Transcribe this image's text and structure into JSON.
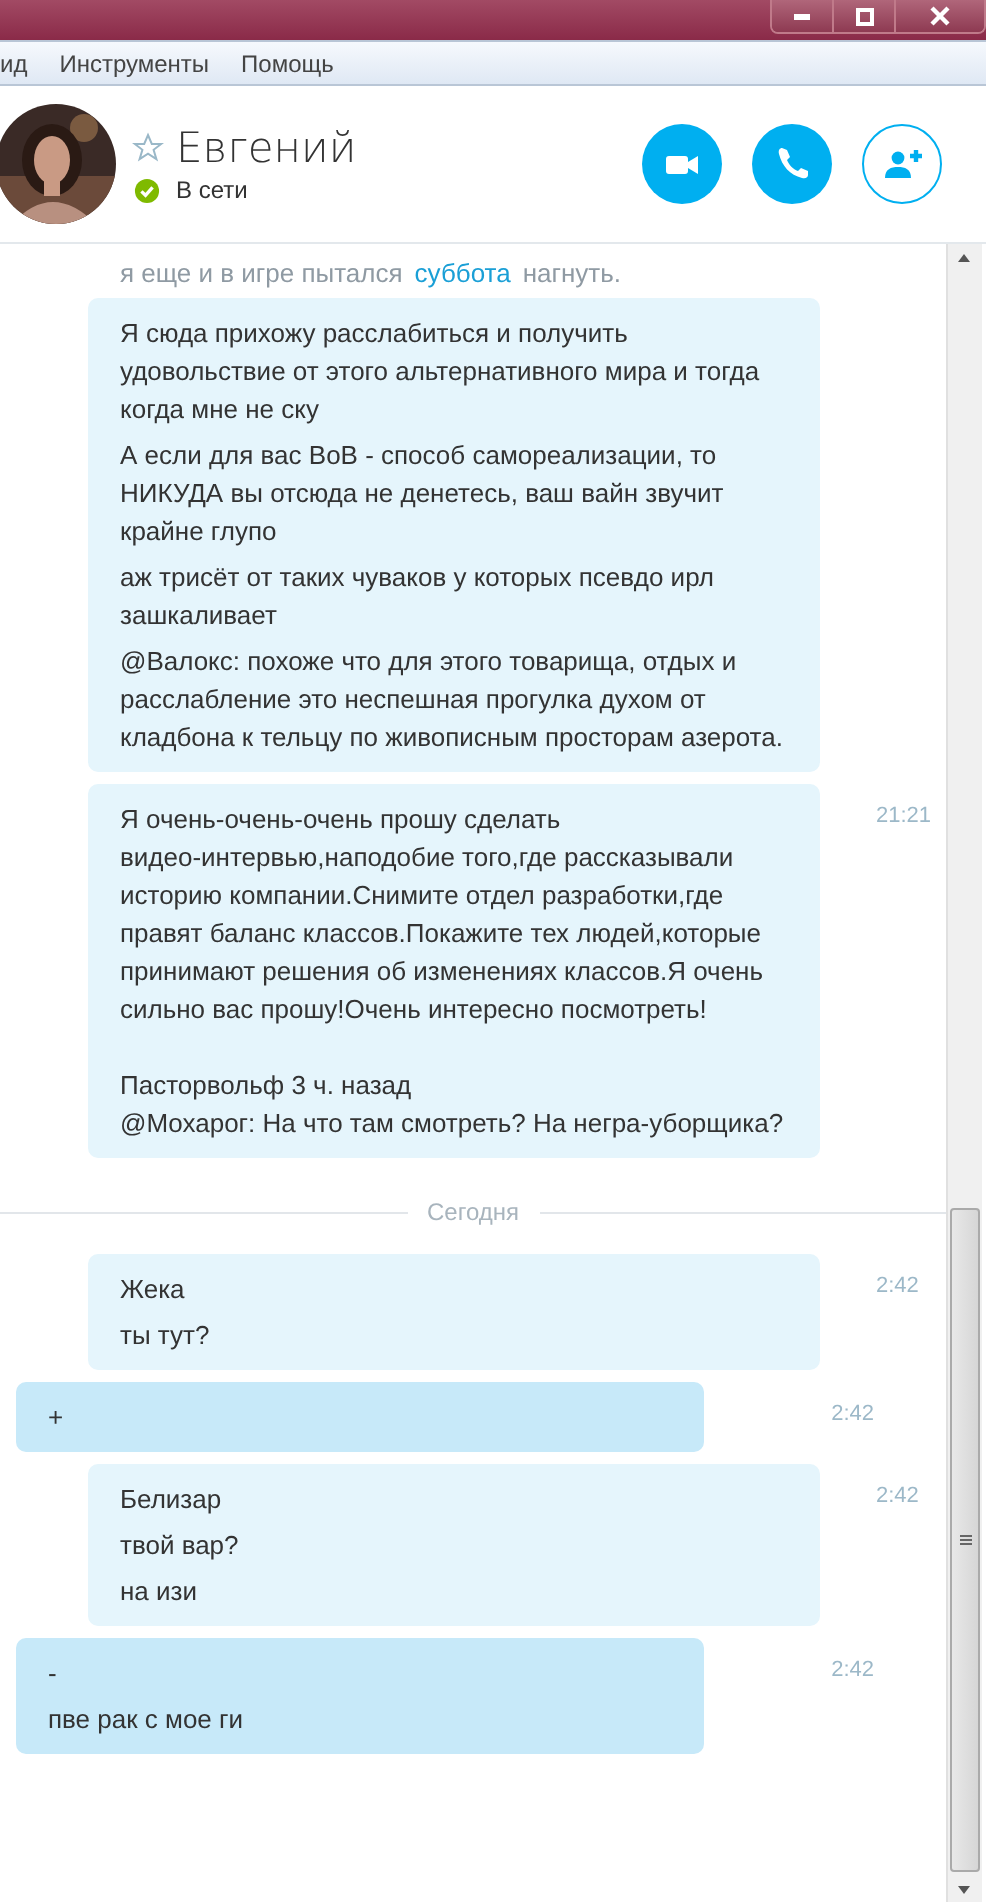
{
  "window": {
    "controls": [
      {
        "kind": "minimize"
      },
      {
        "kind": "maximize"
      },
      {
        "kind": "close"
      }
    ]
  },
  "menu": [
    "ид",
    "Инструменты",
    "Помощь"
  ],
  "contact": {
    "name": "Евгений",
    "favorite": false,
    "status": "В сети",
    "online": true
  },
  "actions": [
    {
      "kind": "video",
      "outlined": false
    },
    {
      "kind": "call",
      "outlined": false
    },
    {
      "kind": "add-contact",
      "outlined": true
    }
  ],
  "faded_lines": [
    {
      "text": "я еще и в игре пытался"
    },
    {
      "text": "нагнуть."
    }
  ],
  "day_label": "суббота",
  "messages": [
    {
      "kind": "incoming",
      "paragraphs": [
        "Я сюда прихожу расслабиться и получить удовольствие от этого альтернативного мира и тогда когда мне не ску",
        "А если для вас ВоВ - способ самореализации, то НИКУДА вы отсюда не денетесь, ваш вайн звучит крайне глупо",
        "аж трисёт от таких чуваков у которых псевдо ирл зашкаливает",
        "@Валокс: похоже что для этого товарища, отдых и расслабление это неспешная прогулка духом от кладбона к тельцу по живописным просторам азерота."
      ]
    },
    {
      "kind": "incoming",
      "time": "21:21",
      "paragraphs": [
        "Я очень-очень-очень прошу сделать\nвидео-интервью,наподобие того,где рассказывали историю компании.Снимите отдел разработки,где правят баланс классов.Покажите тех людей,которые принимают решения об изменениях классов.Я очень сильно вас прошу!Очень интересно посмотреть!\n\nПасторвольф 3 ч. назад\n@Мохарог: На что там смотреть? На негра-уборщика?"
      ]
    }
  ],
  "divider": "Сегодня",
  "today": [
    {
      "kind": "incoming",
      "time": "2:42",
      "paragraphs": [
        "Жека",
        "ты тут?"
      ]
    },
    {
      "kind": "outgoing",
      "time": "2:42",
      "paragraphs": [
        "+"
      ]
    },
    {
      "kind": "incoming",
      "time": "2:42",
      "paragraphs": [
        "Белизар",
        "твой вар?",
        "на изи"
      ]
    },
    {
      "kind": "outgoing",
      "time": "2:42",
      "paragraphs": [
        "-",
        "пве рак с мое ги"
      ]
    }
  ]
}
